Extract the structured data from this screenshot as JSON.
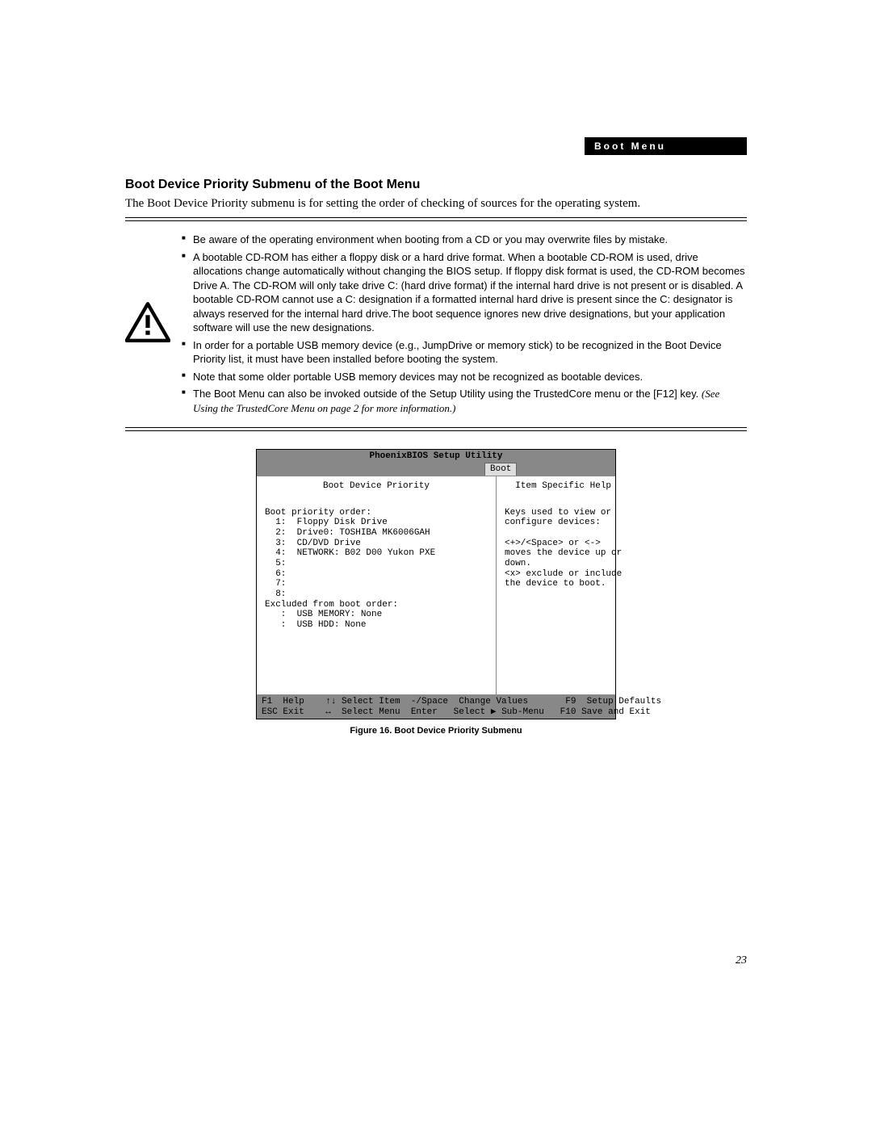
{
  "header": {
    "label": "Boot Menu"
  },
  "section": {
    "title": "Boot Device Priority Submenu of the Boot Menu",
    "intro": "The Boot Device Priority submenu is for setting the order of checking of sources for the operating system."
  },
  "notes": [
    "Be aware of the operating environment when booting from a CD or you may overwrite files by mistake.",
    "A bootable CD-ROM has either a floppy disk or a hard drive format. When a bootable CD-ROM is used, drive allocations change automatically without changing the BIOS setup. If floppy disk format is used, the CD-ROM becomes Drive A. The CD-ROM will only take drive C: (hard drive format) if the internal hard drive is not present or is disabled. A bootable CD-ROM cannot use a C: designation if a formatted internal hard drive is present since the C: designator is always reserved for the internal hard drive.The boot sequence ignores new drive designations, but your application software will use the new designations.",
    "In order for a portable USB memory device (e.g., JumpDrive or memory stick) to be recognized in the Boot Device Priority list, it must have been installed before booting the system.",
    "Note that some older portable USB memory devices may not be recognized as bootable devices."
  ],
  "note5": {
    "prefix": "The Boot Menu can also be invoked outside of the Setup Utility using the TrustedCore menu or the [F12] key. ",
    "italic": "(See Using the TrustedCore Menu on page 2 for more information.)"
  },
  "bios": {
    "title": "PhoenixBIOS Setup Utility",
    "tab": "Boot",
    "left_title": "Boot Device Priority",
    "right_title": "Item Specific Help",
    "left_block": "Boot priority order:\n  1:  Floppy Disk Drive\n  2:  Drive0: TOSHIBA MK6006GAH\n  3:  CD/DVD Drive\n  4:  NETWORK: B02 D00 Yukon PXE\n  5:\n  6:\n  7:\n  8:\nExcluded from boot order:\n   :  USB MEMORY: None\n   :  USB HDD: None",
    "right_block": "Keys used to view or\nconfigure devices:\n\n<+>/<Space> or <->\nmoves the device up or\ndown.\n<x> exclude or include\nthe device to boot.",
    "footer_lines": [
      "F1  Help    ↑↓ Select Item  -/Space  Change Values       F9  Setup Defaults",
      "ESC Exit    ↔  Select Menu  Enter   Select ▶ Sub-Menu   F10 Save and Exit"
    ]
  },
  "figure_caption": "Figure 16.  Boot Device Priority Submenu",
  "page_number": "23",
  "chart_data": {
    "type": "table",
    "title": "PhoenixBIOS Setup Utility — Boot Device Priority",
    "boot_priority_order": [
      {
        "slot": 1,
        "device": "Floppy Disk Drive"
      },
      {
        "slot": 2,
        "device": "Drive0: TOSHIBA MK6006GAH"
      },
      {
        "slot": 3,
        "device": "CD/DVD Drive"
      },
      {
        "slot": 4,
        "device": "NETWORK: B02 D00 Yukon PXE"
      },
      {
        "slot": 5,
        "device": ""
      },
      {
        "slot": 6,
        "device": ""
      },
      {
        "slot": 7,
        "device": ""
      },
      {
        "slot": 8,
        "device": ""
      }
    ],
    "excluded_from_boot_order": [
      {
        "device": "USB MEMORY",
        "value": "None"
      },
      {
        "device": "USB HDD",
        "value": "None"
      }
    ],
    "help_keys": [
      {
        "key": "<+>/<Space> or <->",
        "action": "moves the device up or down."
      },
      {
        "key": "<x>",
        "action": "exclude or include the device to boot."
      }
    ],
    "footer_keys": [
      {
        "key": "F1",
        "action": "Help"
      },
      {
        "key": "↑↓",
        "action": "Select Item"
      },
      {
        "key": "-/Space",
        "action": "Change Values"
      },
      {
        "key": "F9",
        "action": "Setup Defaults"
      },
      {
        "key": "ESC",
        "action": "Exit"
      },
      {
        "key": "↔",
        "action": "Select Menu"
      },
      {
        "key": "Enter",
        "action": "Select ▶ Sub-Menu"
      },
      {
        "key": "F10",
        "action": "Save and Exit"
      }
    ]
  }
}
